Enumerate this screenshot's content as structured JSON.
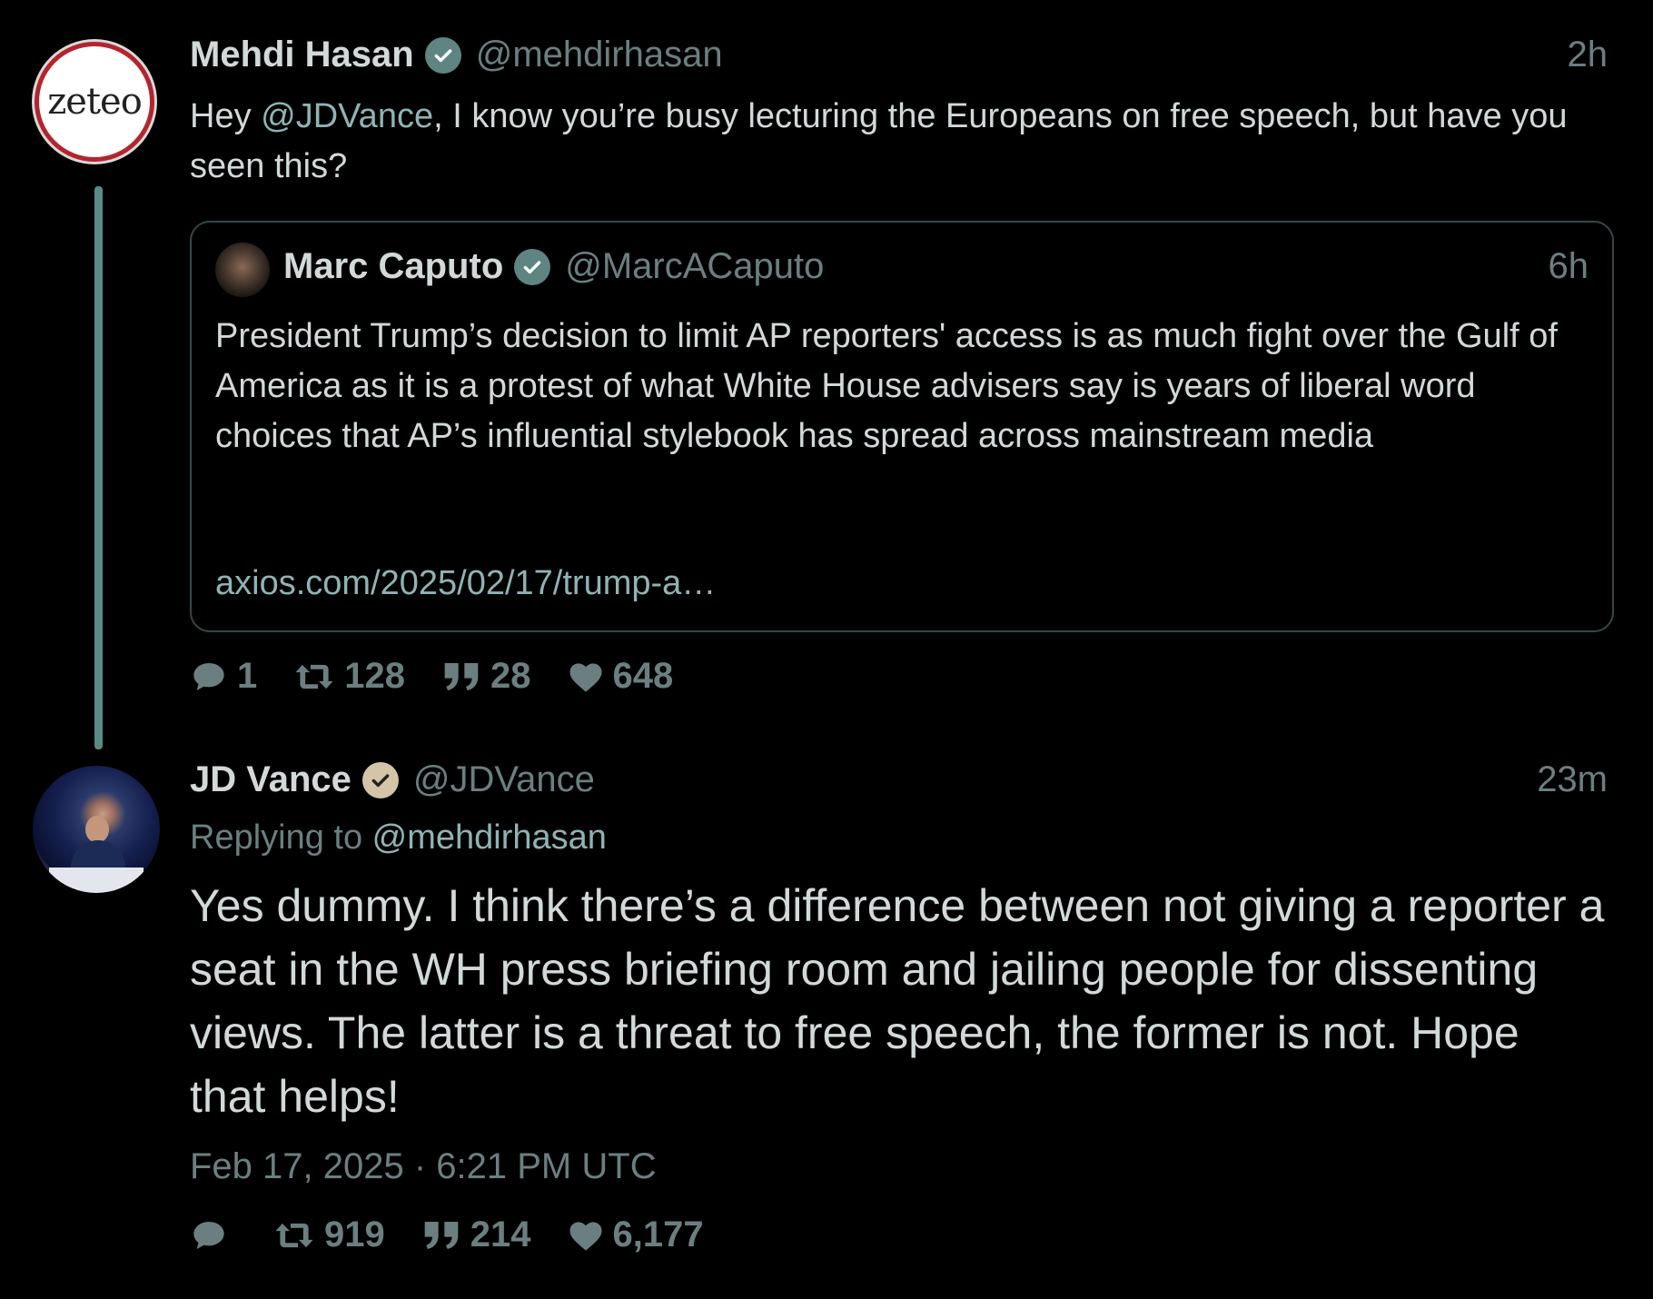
{
  "tweet1": {
    "author_name": "Mehdi Hasan",
    "author_handle": "@mehdirhasan",
    "time": "2h",
    "avatar_text": "zeteo",
    "text_prefix": "Hey ",
    "text_mention": "@JDVance",
    "text_rest": ", I know you’re busy lecturing the Europeans on free speech, but have you seen this?",
    "stats": {
      "replies": "1",
      "retweets": "128",
      "quotes": "28",
      "likes": "648"
    }
  },
  "quote": {
    "author_name": "Marc Caputo",
    "author_handle": "@MarcACaputo",
    "time": "6h",
    "text": "President Trump’s decision to limit AP reporters' access is as much fight over the Gulf of America as it is a protest of what White House advisers say is years of liberal word choices that AP’s influential stylebook has spread across mainstream media",
    "link": "axios.com/2025/02/17/trump-a…"
  },
  "tweet2": {
    "author_name": "JD Vance",
    "author_handle": "@JDVance",
    "time": "23m",
    "replying_prefix": "Replying to ",
    "replying_to": "@mehdirhasan",
    "text": "Yes dummy. I think there’s a difference between not giving a reporter a seat in the WH press briefing room and jailing people for dissenting views. The latter is a threat to free speech, the former is not. Hope that helps!",
    "date": "Feb 17, 2025 · 6:21 PM UTC",
    "stats": {
      "replies": "",
      "retweets": "919",
      "quotes": "214",
      "likes": "6,177"
    }
  },
  "colors": {
    "background": "#000000",
    "text": "#d1d9d9",
    "muted": "#6b7f80",
    "thread_line": "#5a8a86",
    "verified_teal": "#5f8583",
    "verified_gold": "#d4c4a8",
    "zeteo_ring": "#b3252e"
  }
}
